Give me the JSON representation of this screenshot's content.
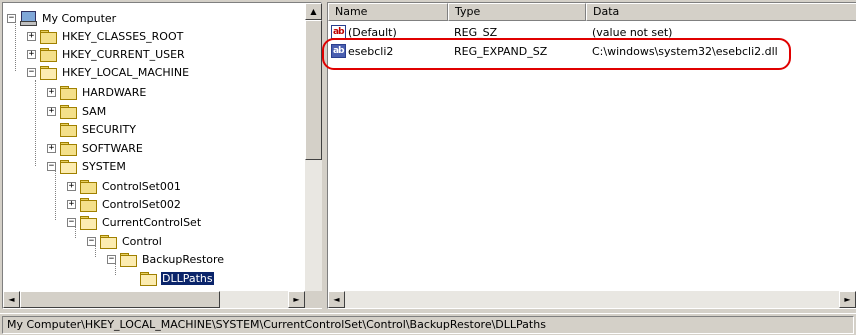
{
  "tree": {
    "items": [
      {
        "label": "My Computer",
        "expander": "−",
        "icon": "computer-icon"
      },
      {
        "label": "HKEY_CLASSES_ROOT",
        "expander": "+",
        "icon": "folder-icon"
      },
      {
        "label": "HKEY_CURRENT_USER",
        "expander": "+",
        "icon": "folder-icon"
      },
      {
        "label": "HKEY_LOCAL_MACHINE",
        "expander": "−",
        "icon": "folder-icon"
      },
      {
        "label": "HARDWARE",
        "expander": "+",
        "icon": "folder-icon"
      },
      {
        "label": "SAM",
        "expander": "+",
        "icon": "folder-icon"
      },
      {
        "label": "SECURITY",
        "expander": "",
        "icon": "folder-icon"
      },
      {
        "label": "SOFTWARE",
        "expander": "+",
        "icon": "folder-icon"
      },
      {
        "label": "SYSTEM",
        "expander": "−",
        "icon": "folder-icon"
      },
      {
        "label": "ControlSet001",
        "expander": "+",
        "icon": "folder-icon"
      },
      {
        "label": "ControlSet002",
        "expander": "+",
        "icon": "folder-icon"
      },
      {
        "label": "CurrentControlSet",
        "expander": "−",
        "icon": "folder-icon"
      },
      {
        "label": "Control",
        "expander": "−",
        "icon": "folder-icon"
      },
      {
        "label": "BackupRestore",
        "expander": "−",
        "icon": "folder-icon"
      },
      {
        "label": "DLLPaths",
        "expander": "",
        "icon": "folder-icon",
        "selected": true
      }
    ]
  },
  "list": {
    "columns": [
      "Name",
      "Type",
      "Data"
    ],
    "rows": [
      {
        "name": "(Default)",
        "type": "REG_SZ",
        "data": "(value not set)",
        "icon": "ab-icon"
      },
      {
        "name": "esebcli2",
        "type": "REG_EXPAND_SZ",
        "data": "C:\\windows\\system32\\esebcli2.dll",
        "icon": "ab-icon"
      }
    ]
  },
  "scroll": {
    "up": "▲",
    "left": "◄",
    "right": "►"
  },
  "status": {
    "path": "My Computer\\HKEY_LOCAL_MACHINE\\SYSTEM\\CurrentControlSet\\Control\\BackupRestore\\DLLPaths"
  },
  "colors": {
    "highlight": "#e00000",
    "selection": "#0a246a"
  }
}
